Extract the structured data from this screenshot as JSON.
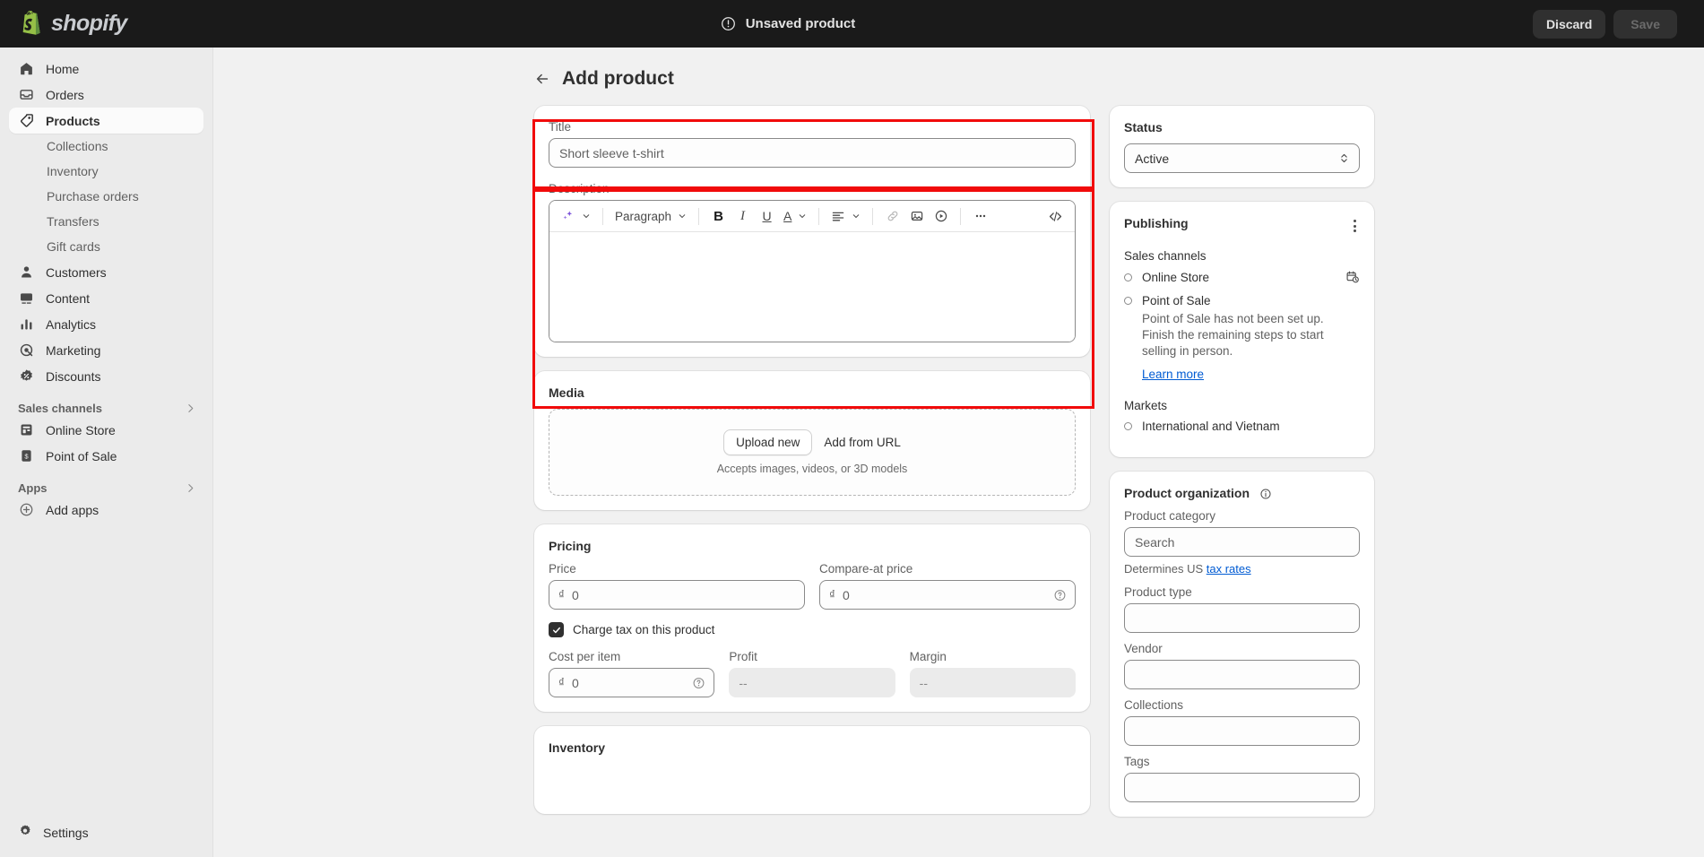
{
  "topbar": {
    "brand": "shopify",
    "status_text": "Unsaved product",
    "discard_label": "Discard",
    "save_label": "Save"
  },
  "sidebar": {
    "items": [
      {
        "label": "Home",
        "icon": "home-icon",
        "active": false
      },
      {
        "label": "Orders",
        "icon": "orders-icon",
        "active": false
      },
      {
        "label": "Products",
        "icon": "products-tag-icon",
        "active": true
      }
    ],
    "product_sub_items": [
      {
        "label": "Collections"
      },
      {
        "label": "Inventory"
      },
      {
        "label": "Purchase orders"
      },
      {
        "label": "Transfers"
      },
      {
        "label": "Gift cards"
      }
    ],
    "items2": [
      {
        "label": "Customers",
        "icon": "customers-icon"
      },
      {
        "label": "Content",
        "icon": "content-icon"
      },
      {
        "label": "Analytics",
        "icon": "analytics-bars-icon"
      },
      {
        "label": "Marketing",
        "icon": "marketing-target-icon"
      },
      {
        "label": "Discounts",
        "icon": "discounts-badge-icon"
      }
    ],
    "sales_channels_header": "Sales channels",
    "sales_channels": [
      {
        "label": "Online Store",
        "icon": "store-icon"
      },
      {
        "label": "Point of Sale",
        "icon": "pos-icon"
      }
    ],
    "apps_header": "Apps",
    "apps": [
      {
        "label": "Add apps",
        "icon": "plus-circle-icon"
      }
    ],
    "settings_label": "Settings"
  },
  "page": {
    "title": "Add product",
    "back_icon": "back-arrow-icon"
  },
  "title_card": {
    "label": "Title",
    "placeholder": "Short sleeve t-shirt",
    "value": ""
  },
  "description_card": {
    "label": "Description",
    "toolbar": {
      "ai_icon": "sparkle-ai-icon",
      "block_format": "Paragraph",
      "bold": "B",
      "italic": "I",
      "underline": "U",
      "text_color": "A",
      "align_icon": "align-left-icon",
      "link_icon": "link-icon",
      "image_icon": "insert-image-icon",
      "video_icon": "insert-video-icon",
      "more_icon": "more-horizontal-icon",
      "code_icon": "code-icon"
    },
    "content": ""
  },
  "media_card": {
    "title": "Media",
    "upload_label": "Upload new",
    "add_url_label": "Add from URL",
    "hint": "Accepts images, videos, or 3D models"
  },
  "pricing_card": {
    "title": "Pricing",
    "currency_symbol": "₫",
    "price": {
      "label": "Price",
      "value": "0"
    },
    "compare_at": {
      "label": "Compare-at price",
      "value": "0",
      "help_icon": "question-circle-icon"
    },
    "charge_tax": {
      "label": "Charge tax on this product",
      "checked": true
    },
    "cost_per_item": {
      "label": "Cost per item",
      "value": "0",
      "help_icon": "question-circle-icon"
    },
    "profit": {
      "label": "Profit",
      "value": "--"
    },
    "margin": {
      "label": "Margin",
      "value": "--"
    }
  },
  "inventory_card": {
    "title": "Inventory"
  },
  "status_card": {
    "title": "Status",
    "value": "Active",
    "chevron_icon": "chevron-up-down-icon"
  },
  "publishing_card": {
    "title": "Publishing",
    "menu_icon": "kebab-menu-icon",
    "sales_channels_label": "Sales channels",
    "channels": [
      {
        "name": "Online Store",
        "trailing_icon": "calendar-clock-icon",
        "description": "",
        "learn_more": ""
      },
      {
        "name": "Point of Sale",
        "trailing_icon": "",
        "description": "Point of Sale has not been set up. Finish the remaining steps to start selling in person.",
        "learn_more": "Learn more"
      }
    ],
    "markets_label": "Markets",
    "markets": [
      {
        "name": "International and Vietnam"
      }
    ]
  },
  "organization_card": {
    "title": "Product organization",
    "info_icon": "info-circle-icon",
    "product_category": {
      "label": "Product category",
      "placeholder": "Search",
      "value": ""
    },
    "tax_hint_prefix": "Determines US ",
    "tax_hint_link": "tax rates",
    "product_type": {
      "label": "Product type",
      "value": ""
    },
    "vendor": {
      "label": "Vendor",
      "value": ""
    },
    "collections": {
      "label": "Collections",
      "value": ""
    },
    "tags": {
      "label": "Tags",
      "value": ""
    }
  },
  "annotations": {
    "color": "#f10b0b",
    "boxes": [
      {
        "name": "title-field-highlight"
      },
      {
        "name": "description-field-highlight"
      }
    ]
  }
}
